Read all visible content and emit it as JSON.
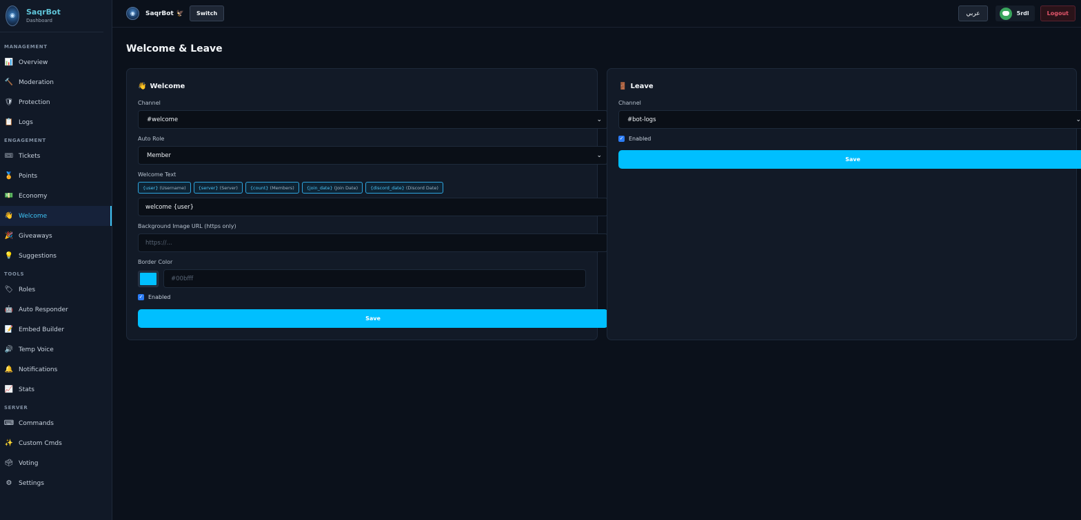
{
  "brand": {
    "name": "SaqrBot",
    "subtitle": "Dashboard"
  },
  "sidebar": {
    "sections": [
      {
        "title": "MANAGEMENT",
        "items": [
          {
            "label": "Overview",
            "icon": "📊",
            "icon_name": "bar-chart-icon"
          },
          {
            "label": "Moderation",
            "icon": "🔨",
            "icon_name": "hammer-icon"
          },
          {
            "label": "Protection",
            "icon": "🛡",
            "icon_name": "shield-icon"
          },
          {
            "label": "Logs",
            "icon": "📋",
            "icon_name": "clipboard-icon"
          }
        ]
      },
      {
        "title": "ENGAGEMENT",
        "items": [
          {
            "label": "Tickets",
            "icon": "🎟",
            "icon_name": "ticket-icon"
          },
          {
            "label": "Points",
            "icon": "🏅",
            "icon_name": "medal-icon"
          },
          {
            "label": "Economy",
            "icon": "💵",
            "icon_name": "money-icon"
          },
          {
            "label": "Welcome",
            "icon": "👋",
            "icon_name": "wave-icon",
            "active": true
          },
          {
            "label": "Giveaways",
            "icon": "🎉",
            "icon_name": "party-icon"
          },
          {
            "label": "Suggestions",
            "icon": "💡",
            "icon_name": "lightbulb-icon"
          }
        ]
      },
      {
        "title": "TOOLS",
        "items": [
          {
            "label": "Roles",
            "icon": "🏷",
            "icon_name": "tag-icon"
          },
          {
            "label": "Auto Responder",
            "icon": "🤖",
            "icon_name": "robot-icon"
          },
          {
            "label": "Embed Builder",
            "icon": "📝",
            "icon_name": "memo-icon"
          },
          {
            "label": "Temp Voice",
            "icon": "🔊",
            "icon_name": "speaker-icon"
          },
          {
            "label": "Notifications",
            "icon": "🔔",
            "icon_name": "bell-icon"
          },
          {
            "label": "Stats",
            "icon": "📈",
            "icon_name": "trend-chart-icon"
          }
        ]
      },
      {
        "title": "SERVER",
        "items": [
          {
            "label": "Commands",
            "icon": "⌨",
            "icon_name": "keyboard-icon"
          },
          {
            "label": "Custom Cmds",
            "icon": "✨",
            "icon_name": "sparkles-icon"
          },
          {
            "label": "Voting",
            "icon": "🗳",
            "icon_name": "ballot-icon"
          },
          {
            "label": "Settings",
            "icon": "⚙",
            "icon_name": "gear-icon"
          }
        ]
      }
    ]
  },
  "topbar": {
    "server_name": "SaqrBot",
    "server_flag": "🦅",
    "switch_label": "Switch",
    "lang_label": "عربي",
    "user_name": "5rdl",
    "logout_label": "Logout"
  },
  "page": {
    "title": "Welcome & Leave"
  },
  "welcome": {
    "icon": "👋",
    "title": "Welcome",
    "channel_label": "Channel",
    "channel_value": "#welcome",
    "auto_role_label": "Auto Role",
    "auto_role_value": "Member",
    "text_label": "Welcome Text",
    "chips": [
      {
        "token": "{user}",
        "desc": "(Username)"
      },
      {
        "token": "{server}",
        "desc": "(Server)"
      },
      {
        "token": "{count}",
        "desc": "(Members)"
      },
      {
        "token": "{join_date}",
        "desc": "(Join Date)"
      },
      {
        "token": "{discord_date}",
        "desc": "(Discord Date)"
      }
    ],
    "text_value": "welcome {user}",
    "bg_label": "Background Image URL (https only)",
    "bg_placeholder": "https://...",
    "border_label": "Border Color",
    "border_value": "#00bfff",
    "enabled_label": "Enabled",
    "save_label": "Save"
  },
  "leave": {
    "icon": "🚪",
    "title": "Leave",
    "channel_label": "Channel",
    "channel_value": "#bot-logs",
    "enabled_label": "Enabled",
    "save_label": "Save"
  },
  "colors": {
    "accent": "#00bfff",
    "active_nav": "#3ec4f5",
    "logout": "#e3566b"
  }
}
